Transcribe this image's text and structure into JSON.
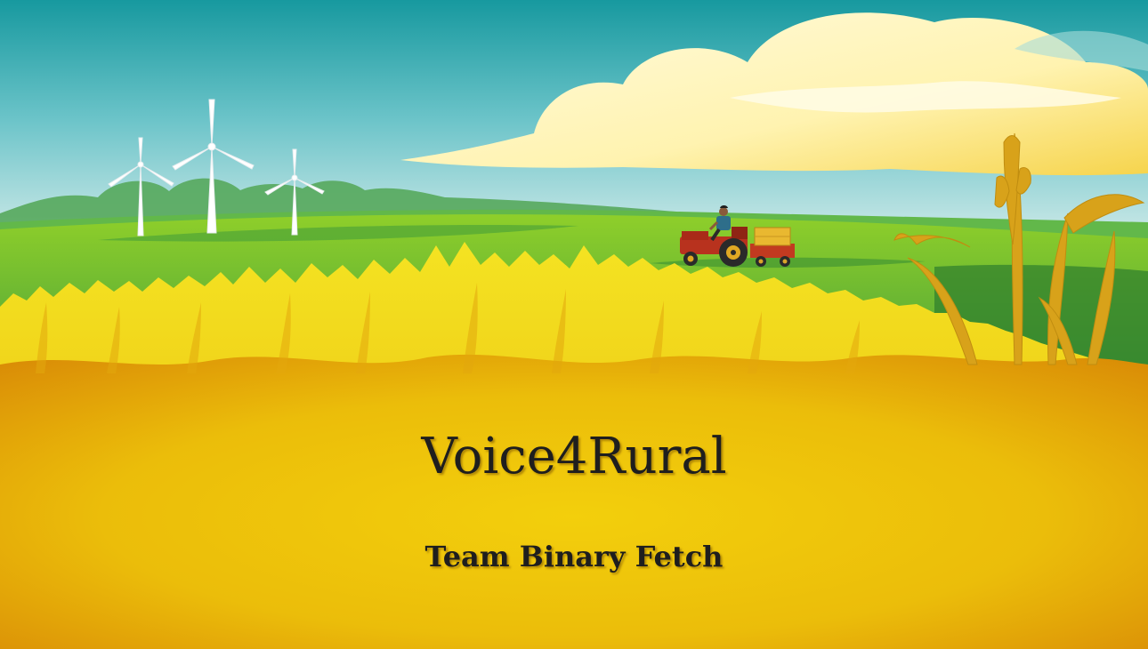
{
  "slide": {
    "title": "Voice4Rural",
    "subtitle": "Team Binary Fetch"
  },
  "palette": {
    "sky_top": "#1aa2a9",
    "sky_bottom": "#d8eef0",
    "cloud": "#fff6c4",
    "cloud_glow": "#f5d24a",
    "hills": "#5fb24a",
    "field_green": "#7cc22c",
    "wheat_light": "#f1dc1e",
    "wheat_dark": "#e7a20b",
    "ground_edge": "#d88a06",
    "tractor_red": "#b8321e",
    "trailer_hay": "#e9b830",
    "text": "#1e1e1e"
  },
  "scene": {
    "elements": [
      "wind-turbine",
      "wind-turbine",
      "wind-turbine",
      "tractor-with-farmer",
      "hay-trailer",
      "wheat-stalks",
      "clouds"
    ]
  }
}
